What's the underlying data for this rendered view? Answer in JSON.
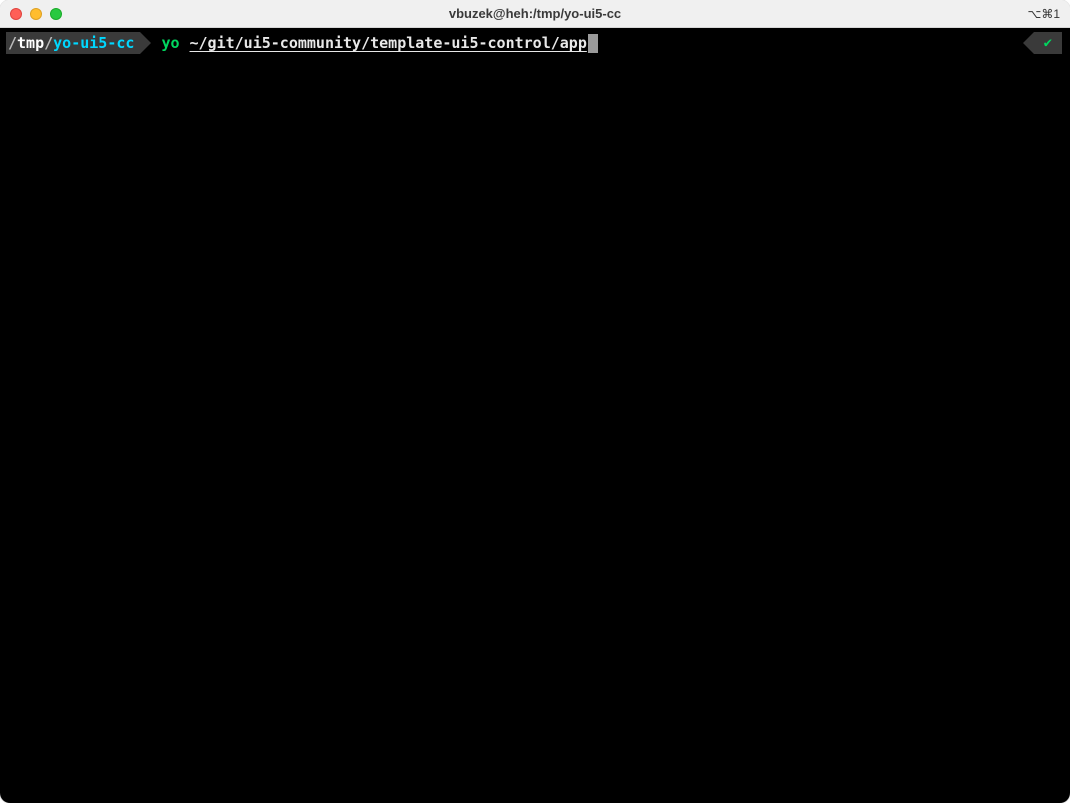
{
  "window": {
    "title": "vbuzek@heh:/tmp/yo-ui5-cc",
    "shortcut": "⌥⌘1"
  },
  "prompt": {
    "cwd_prefix": "/",
    "cwd_mid": "tmp",
    "cwd_sep": "/",
    "cwd_leaf": "yo-ui5-cc",
    "command": "yo",
    "args": "~/git/ui5-community/template-ui5-control/app"
  },
  "status": {
    "icon": "✔"
  }
}
